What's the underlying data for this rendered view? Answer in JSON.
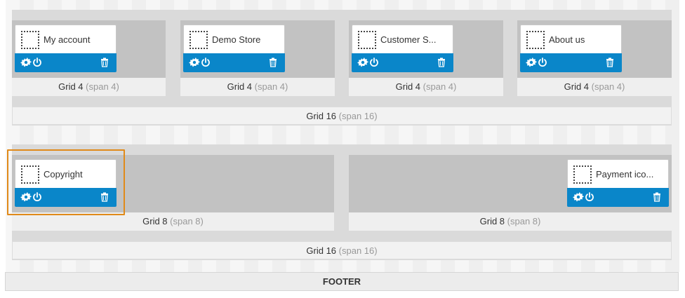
{
  "rows": [
    {
      "grid16": {
        "label": "Grid 16",
        "span": "(span 16)"
      },
      "columns": [
        {
          "label": "Grid 4",
          "span": "(span 4)",
          "modules": [
            {
              "title": "My account"
            }
          ]
        },
        {
          "label": "Grid 4",
          "span": "(span 4)",
          "modules": [
            {
              "title": "Demo Store"
            }
          ]
        },
        {
          "label": "Grid 4",
          "span": "(span 4)",
          "modules": [
            {
              "title": "Customer S..."
            }
          ]
        },
        {
          "label": "Grid 4",
          "span": "(span 4)",
          "modules": [
            {
              "title": "About us"
            }
          ]
        }
      ]
    },
    {
      "grid16": {
        "label": "Grid 16",
        "span": "(span 16)"
      },
      "columns": [
        {
          "label": "Grid 8",
          "span": "(span 8)",
          "modules": [
            {
              "title": "Copyright",
              "selected": true
            }
          ]
        },
        {
          "label": "Grid 8",
          "span": "(span 8)",
          "modules": [
            {
              "title": "Payment ico..."
            }
          ]
        }
      ]
    }
  ],
  "footer": {
    "label": "FOOTER"
  },
  "icons": {
    "settings": "gear-icon",
    "toggle": "power-icon",
    "delete": "trash-icon",
    "module": "module-placeholder-icon"
  },
  "colors": {
    "module_bar": "#0a86c9",
    "selection": "#e08a1a",
    "column": "#c2c2c2"
  }
}
